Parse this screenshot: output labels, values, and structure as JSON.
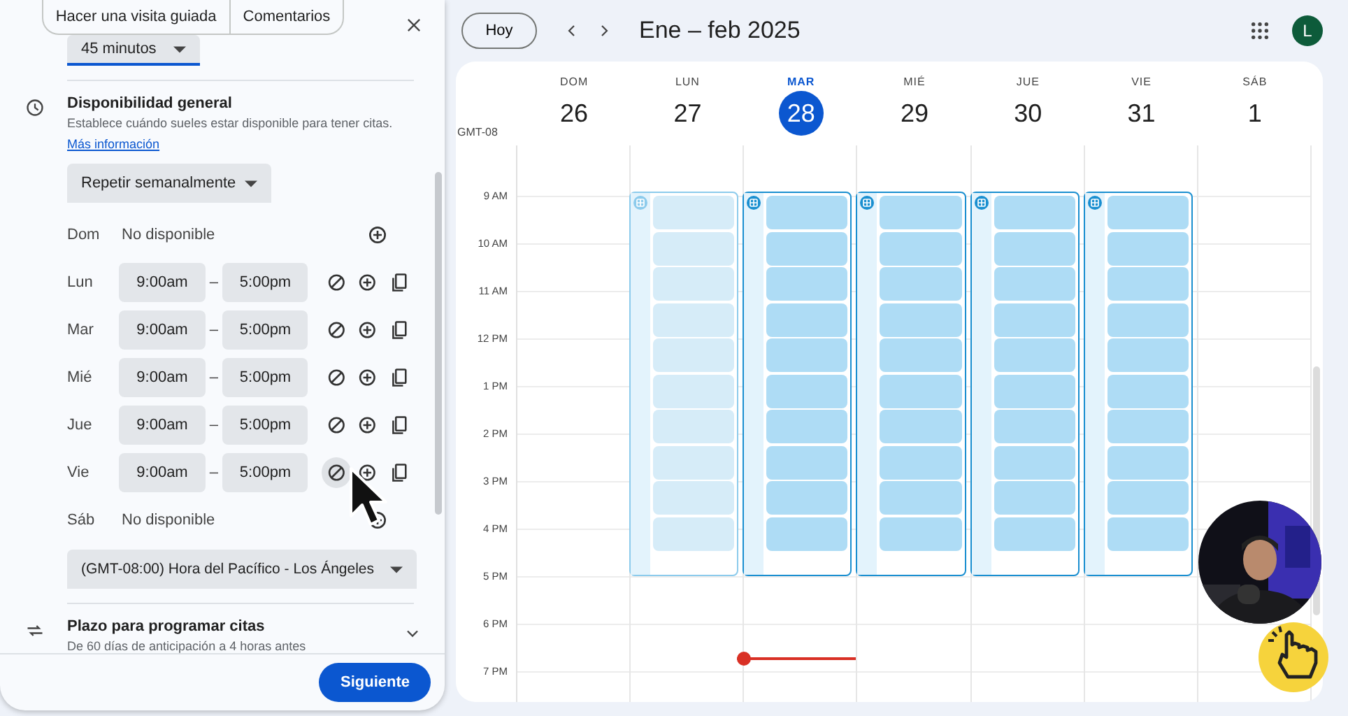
{
  "panel": {
    "tabs": [
      {
        "label": "Hacer una visita guiada"
      },
      {
        "label": "Comentarios"
      }
    ],
    "duration": {
      "value": "45 minutos"
    },
    "availability": {
      "title": "Disponibilidad general",
      "description": "Establece cuándo sueles estar disponible para tener citas.",
      "link": "Más información",
      "repeat": "Repetir semanalmente",
      "days": [
        {
          "day": "Dom",
          "kind": "unavailable",
          "text": "No disponible",
          "hovered": false
        },
        {
          "day": "Lun",
          "kind": "hours",
          "start": "9:00am",
          "separator": "–",
          "end": "5:00pm",
          "hovered": false
        },
        {
          "day": "Mar",
          "kind": "hours",
          "start": "9:00am",
          "separator": "–",
          "end": "5:00pm",
          "hovered": false
        },
        {
          "day": "Mié",
          "kind": "hours",
          "start": "9:00am",
          "separator": "–",
          "end": "5:00pm",
          "hovered": false
        },
        {
          "day": "Jue",
          "kind": "hours",
          "start": "9:00am",
          "separator": "–",
          "end": "5:00pm",
          "hovered": false
        },
        {
          "day": "Vie",
          "kind": "hours",
          "start": "9:00am",
          "separator": "–",
          "end": "5:00pm",
          "hovered": true
        },
        {
          "day": "Sáb",
          "kind": "unavailable",
          "text": "No disponible",
          "hovered": false
        }
      ],
      "timezone": "(GMT-08:00) Hora del Pacífico - Los Ángeles"
    },
    "booking_window": {
      "title": "Plazo para programar citas",
      "description": "De 60 días de anticipación a 4 horas antes",
      "expanded": false
    },
    "next_button": "Siguiente"
  },
  "toolbar": {
    "today": "Hoy",
    "title": "Ene – feb 2025",
    "avatar": "L"
  },
  "calendar": {
    "timezone": "GMT-08",
    "days": [
      {
        "weekday": "DOM",
        "date": "26",
        "selected": false,
        "kind": "empty",
        "current_time": false
      },
      {
        "weekday": "LUN",
        "date": "27",
        "selected": false,
        "kind": "past",
        "current_time": false
      },
      {
        "weekday": "MAR",
        "date": "28",
        "selected": true,
        "kind": "open",
        "current_time": true
      },
      {
        "weekday": "MIÉ",
        "date": "29",
        "selected": false,
        "kind": "open",
        "current_time": false
      },
      {
        "weekday": "JUE",
        "date": "30",
        "selected": false,
        "kind": "open",
        "current_time": false
      },
      {
        "weekday": "VIE",
        "date": "31",
        "selected": false,
        "kind": "open",
        "current_time": false
      },
      {
        "weekday": "SÁB",
        "date": "1",
        "selected": false,
        "kind": "empty",
        "current_time": false
      }
    ],
    "hours": [
      "9 AM",
      "10 AM",
      "11 AM",
      "12 PM",
      "1 PM",
      "2 PM",
      "3 PM",
      "4 PM",
      "5 PM",
      "6 PM",
      "7 PM"
    ]
  }
}
